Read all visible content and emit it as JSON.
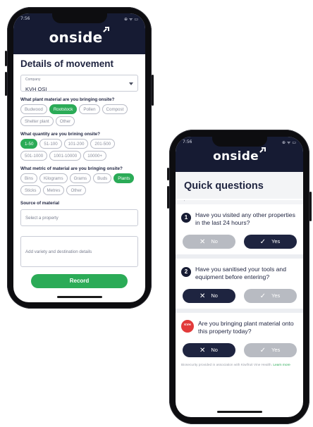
{
  "phone_left": {
    "status_time": "7:56",
    "status_icons": "⊕ ᯤ ▭",
    "logo": "onside",
    "title": "Details of movement",
    "company": {
      "label": "Company",
      "value": "KVH OSI"
    },
    "plant_material": {
      "question": "What plant material are you bringing onsite?",
      "options": [
        "Budwood",
        "Rootstock",
        "Pollen",
        "Compost",
        "Shelter plant",
        "Other"
      ],
      "selected": "Rootstock"
    },
    "quantity": {
      "question": "What quantity are you brining onsite?",
      "options": [
        "1-50",
        "51-100",
        "101-200",
        "201-500",
        "501-1000",
        "1001-10000",
        "10000+"
      ],
      "selected": "1-50"
    },
    "metric": {
      "question": "What metric of material are you bringing onsite?",
      "options": [
        "Bins",
        "Kilograms",
        "Grams",
        "Buds",
        "Plants",
        "Sticks",
        "Metres",
        "Other"
      ],
      "selected": "Plants"
    },
    "source": {
      "label": "Source of material",
      "placeholder": "Select a property"
    },
    "details_placeholder": "Add variety and destination details",
    "record_label": "Record"
  },
  "phone_right": {
    "status_time": "7:56",
    "status_icons": "⊕ ᯤ ▭",
    "logo": "onside",
    "title": "Quick questions",
    "tick": "'",
    "questions": [
      {
        "number": "1",
        "text": "Have you visited any other properties in the last 24 hours?",
        "selected": "Yes"
      },
      {
        "number": "2",
        "text": "Have you sanitised your tools and equipment before entering?",
        "selected": "No"
      },
      {
        "badge": "KVH",
        "text": "Are you bringing plant material onto this property today?",
        "selected": "No"
      }
    ],
    "no_label": "No",
    "yes_label": "Yes",
    "footnote": "Biosecurity provided in association with Kiwifruit Vine Health.",
    "learn_more": "Learn more"
  },
  "colors": {
    "navy": "#161b33",
    "green": "#2bab57",
    "badge_red": "#e23a3a"
  }
}
